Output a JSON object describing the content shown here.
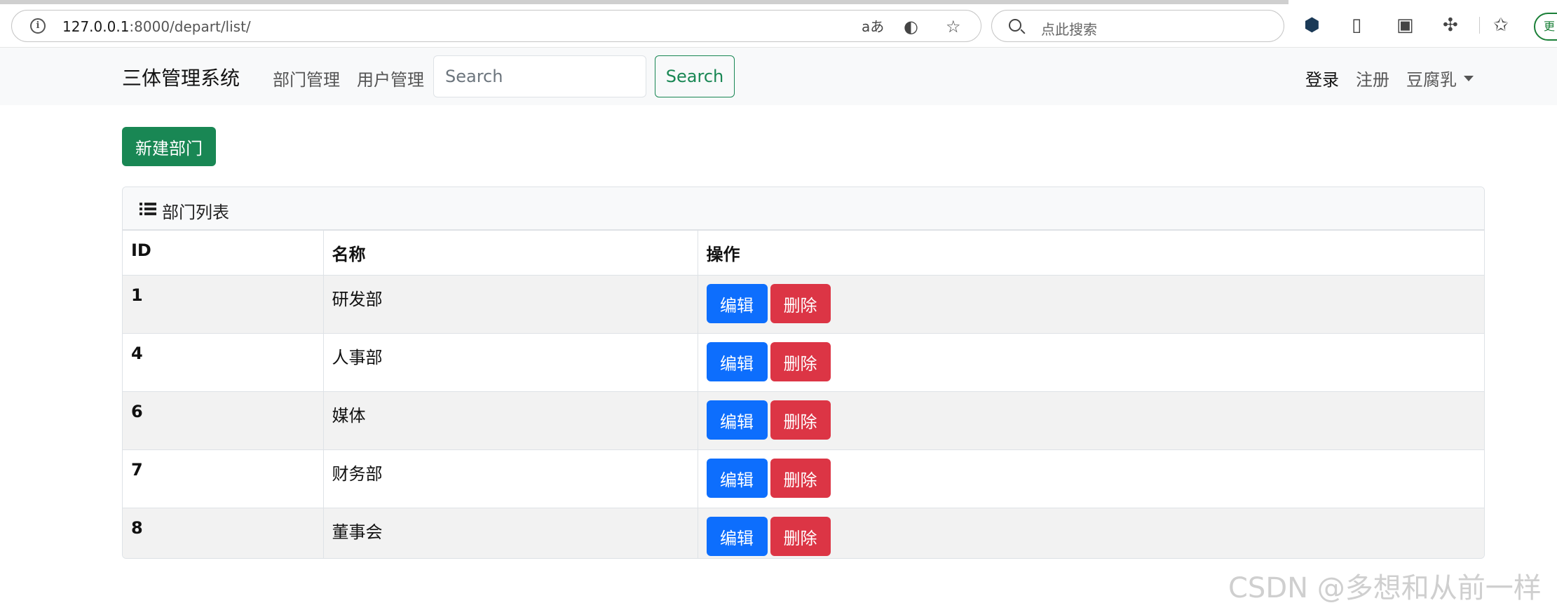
{
  "browser": {
    "url_host": "127.0.0.1",
    "url_rest": ":8000/depart/list/",
    "search_placeholder": "点此搜索",
    "read_aloud_label": "aあ",
    "update_label": "更"
  },
  "navbar": {
    "brand": "三体管理系统",
    "links": [
      "部门管理",
      "用户管理"
    ],
    "search_placeholder": "Search",
    "search_button": "Search",
    "login": "登录",
    "register": "注册",
    "user": "豆腐乳"
  },
  "content": {
    "new_button": "新建部门",
    "card_title": "部门列表",
    "columns": [
      "ID",
      "名称",
      "操作"
    ],
    "rows": [
      {
        "id": "1",
        "name": "研发部"
      },
      {
        "id": "4",
        "name": "人事部"
      },
      {
        "id": "6",
        "name": "媒体"
      },
      {
        "id": "7",
        "name": "财务部"
      },
      {
        "id": "8",
        "name": "董事会"
      }
    ],
    "edit_label": "编辑",
    "delete_label": "删除"
  },
  "colors": {
    "success": "#198754",
    "primary": "#0d6efd",
    "danger": "#dc3545",
    "navbar_bg": "#f8f9fa"
  },
  "watermark": "CSDN @多想和从前一样"
}
